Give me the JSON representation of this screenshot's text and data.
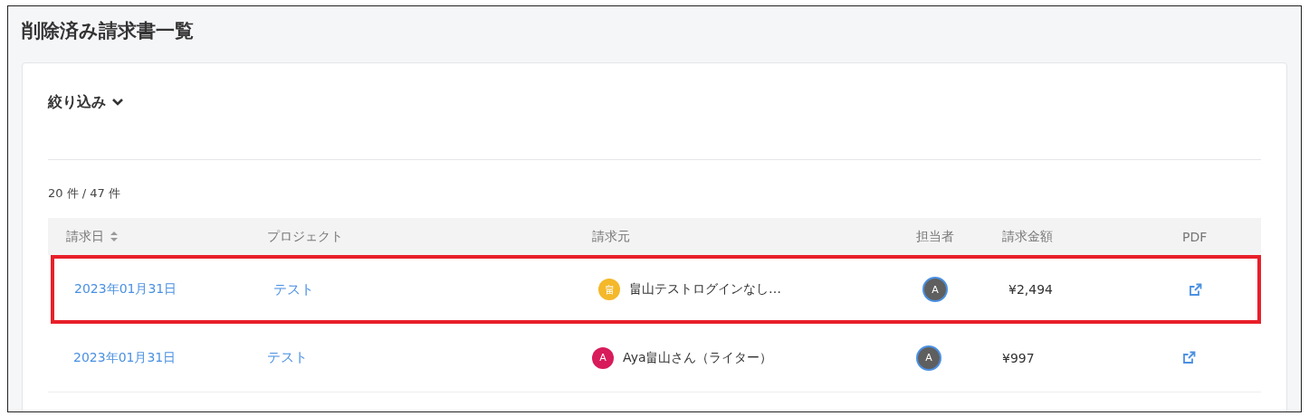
{
  "page": {
    "title": "削除済み請求書一覧"
  },
  "filter": {
    "label": "絞り込み",
    "expanded": false
  },
  "count": "20 件 / 47 件",
  "table": {
    "columns": [
      {
        "label": "請求日",
        "sortable": true
      },
      {
        "label": "プロジェクト",
        "sortable": false
      },
      {
        "label": "請求元",
        "sortable": false
      },
      {
        "label": "担当者",
        "sortable": false
      },
      {
        "label": "請求金額",
        "sortable": false
      },
      {
        "label": "PDF",
        "sortable": false
      }
    ],
    "rows": [
      {
        "date": "2023年01月31日",
        "project": "テスト",
        "client": {
          "initial": "畠",
          "color": "#f4b82a",
          "name": "畠山テストログインなし…"
        },
        "assignee": {
          "initial": "A"
        },
        "amount": "¥2,494",
        "highlighted": true
      },
      {
        "date": "2023年01月31日",
        "project": "テスト",
        "client": {
          "initial": "A",
          "color": "#d81b5a",
          "name": "Aya畠山さん（ライター）"
        },
        "assignee": {
          "initial": "A"
        },
        "amount": "¥997",
        "highlighted": false
      }
    ]
  }
}
